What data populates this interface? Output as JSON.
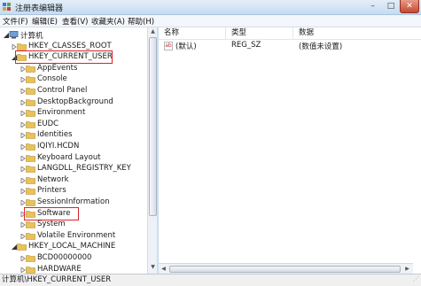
{
  "window": {
    "title": "注册表编辑器",
    "minimize": "–",
    "maximize": "□",
    "close": "✕"
  },
  "menu": [
    "文件(F)",
    "编辑(E)",
    "查看(V)",
    "收藏夹(A)",
    "帮助(H)"
  ],
  "tree": [
    {
      "label": "计算机",
      "icon": "computer-icon",
      "level": 0,
      "expanded": true
    },
    {
      "label": "HKEY_CLASSES_ROOT",
      "icon": "folder-icon",
      "level": 1,
      "expanded": false
    },
    {
      "label": "HKEY_CURRENT_USER",
      "icon": "folder-icon",
      "level": 1,
      "expanded": true,
      "highlighted": true
    },
    {
      "label": "AppEvents",
      "icon": "folder-icon",
      "level": 2,
      "expanded": false
    },
    {
      "label": "Console",
      "icon": "folder-icon",
      "level": 2,
      "expanded": false
    },
    {
      "label": "Control Panel",
      "icon": "folder-icon",
      "level": 2,
      "expanded": false
    },
    {
      "label": "DesktopBackground",
      "icon": "folder-icon",
      "level": 2,
      "expanded": false
    },
    {
      "label": "Environment",
      "icon": "folder-icon",
      "level": 2,
      "expanded": false
    },
    {
      "label": "EUDC",
      "icon": "folder-icon",
      "level": 2,
      "expanded": false
    },
    {
      "label": "Identities",
      "icon": "folder-icon",
      "level": 2,
      "expanded": false
    },
    {
      "label": "IQIYI.HCDN",
      "icon": "folder-icon",
      "level": 2,
      "expanded": false
    },
    {
      "label": "Keyboard Layout",
      "icon": "folder-icon",
      "level": 2,
      "expanded": false
    },
    {
      "label": "LANGDLL_REGISTRY_KEY",
      "icon": "folder-icon",
      "level": 2,
      "expanded": false
    },
    {
      "label": "Network",
      "icon": "folder-icon",
      "level": 2,
      "expanded": false
    },
    {
      "label": "Printers",
      "icon": "folder-icon",
      "level": 2,
      "expanded": false
    },
    {
      "label": "SessionInformation",
      "icon": "folder-icon",
      "level": 2,
      "expanded": false
    },
    {
      "label": "Software",
      "icon": "folder-icon",
      "level": 2,
      "expanded": false,
      "highlighted": true
    },
    {
      "label": "System",
      "icon": "folder-icon",
      "level": 2,
      "expanded": false
    },
    {
      "label": "Volatile Environment",
      "icon": "folder-icon",
      "level": 2,
      "expanded": false
    },
    {
      "label": "HKEY_LOCAL_MACHINE",
      "icon": "folder-icon",
      "level": 1,
      "expanded": true
    },
    {
      "label": "BCD00000000",
      "icon": "folder-icon",
      "level": 2,
      "expanded": false
    },
    {
      "label": "HARDWARE",
      "icon": "folder-icon",
      "level": 2,
      "expanded": false
    }
  ],
  "columns": {
    "name": "名称",
    "type": "类型",
    "data": "数据"
  },
  "values": [
    {
      "name": "(默认)",
      "type": "REG_SZ",
      "data": "(数值未设置)",
      "icon": "ab-string-icon"
    }
  ],
  "status": {
    "path": "计算机\\HKEY_CURRENT_USER"
  },
  "colors": {
    "highlight_border": "#d9232b",
    "folder": "#e8c25a",
    "titlebar": "#c6dbf0"
  }
}
